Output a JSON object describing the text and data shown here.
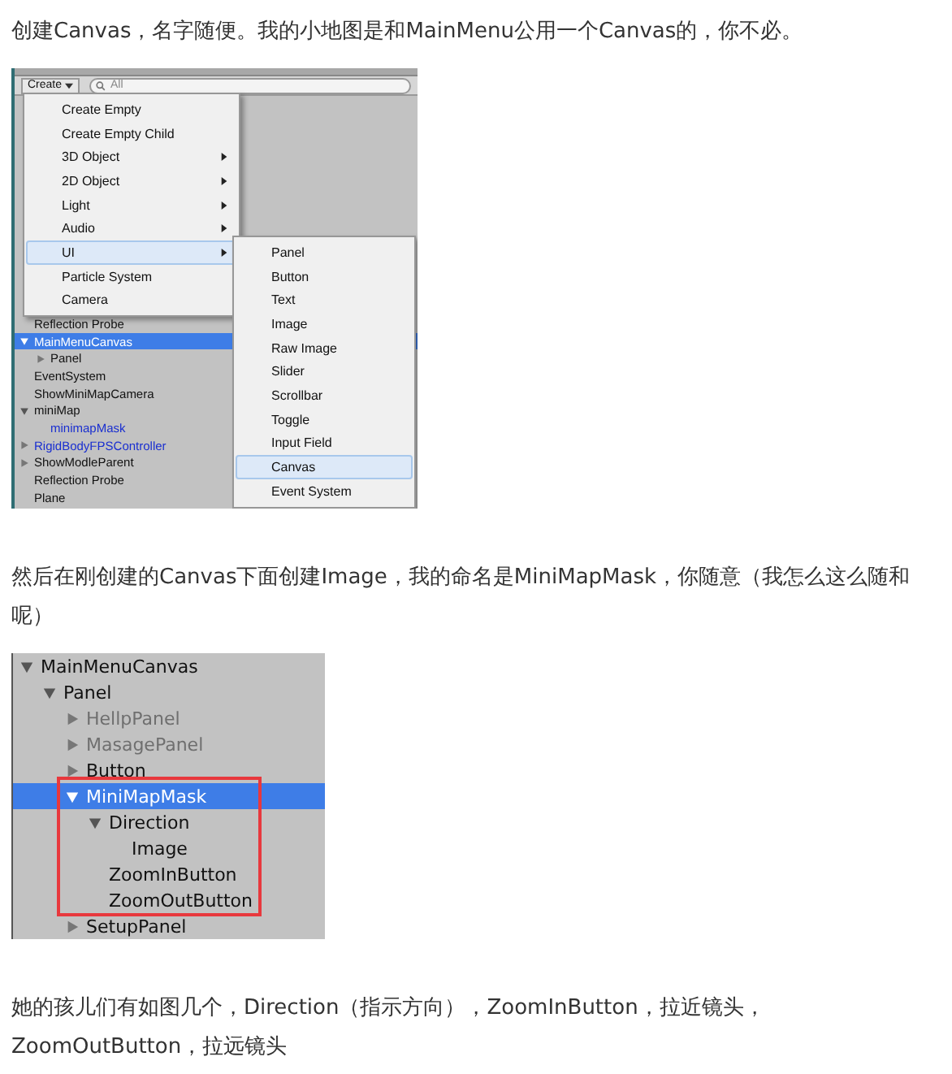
{
  "blocks": [
    {
      "kind": "text",
      "text": "创建Canvas，名字随便。我的小地图是和MainMenu公用一个Canvas的，你不必。"
    },
    {
      "kind": "menu_shot",
      "create_button": "Create",
      "search": {
        "placeholder": "All"
      },
      "menu": [
        {
          "label": "Create Empty",
          "submenu": false,
          "selected": false
        },
        {
          "label": "Create Empty Child",
          "submenu": false,
          "selected": false
        },
        {
          "label": "3D Object",
          "submenu": true,
          "selected": false
        },
        {
          "label": "2D Object",
          "submenu": true,
          "selected": false
        },
        {
          "label": "Light",
          "submenu": true,
          "selected": false
        },
        {
          "label": "Audio",
          "submenu": true,
          "selected": false
        },
        {
          "label": "UI",
          "submenu": true,
          "selected": true
        },
        {
          "label": "Particle System",
          "submenu": false,
          "selected": false
        },
        {
          "label": "Camera",
          "submenu": false,
          "selected": false
        }
      ],
      "submenu": [
        {
          "label": "Panel",
          "selected": false
        },
        {
          "label": "Button",
          "selected": false
        },
        {
          "label": "Text",
          "selected": false
        },
        {
          "label": "Image",
          "selected": false
        },
        {
          "label": "Raw Image",
          "selected": false
        },
        {
          "label": "Slider",
          "selected": false
        },
        {
          "label": "Scrollbar",
          "selected": false
        },
        {
          "label": "Toggle",
          "selected": false
        },
        {
          "label": "Input Field",
          "selected": false
        },
        {
          "label": "Canvas",
          "selected": true
        },
        {
          "label": "Event System",
          "selected": false
        }
      ],
      "tree": [
        {
          "label": "Reflection Probe",
          "kind": "object",
          "selected": false
        },
        {
          "label": "MainMenuCanvas",
          "expanded": true,
          "kind": "object",
          "selected": true,
          "children": [
            {
              "label": "Panel",
              "expanded": false,
              "kind": "object",
              "selected": false
            }
          ]
        },
        {
          "label": "EventSystem",
          "kind": "object",
          "selected": false
        },
        {
          "label": "ShowMiniMapCamera",
          "kind": "object",
          "selected": false
        },
        {
          "label": "miniMap",
          "expanded": true,
          "kind": "object",
          "selected": false,
          "children": [
            {
              "label": "minimapMask",
              "kind": "prefab",
              "selected": false
            }
          ]
        },
        {
          "label": "RigidBodyFPSController",
          "expanded": false,
          "kind": "prefab",
          "selected": false
        },
        {
          "label": "ShowModleParent",
          "expanded": false,
          "kind": "object",
          "selected": false
        },
        {
          "label": "Reflection Probe",
          "kind": "object",
          "selected": false
        },
        {
          "label": "Plane",
          "kind": "object",
          "selected": false
        }
      ]
    },
    {
      "kind": "text",
      "text": "然后在刚创建的Canvas下面创建Image，我的命名是MiniMapMask，你随意（我怎么这么随和呢）"
    },
    {
      "kind": "tree_shot",
      "tree": [
        {
          "label": "MainMenuCanvas",
          "expanded": true,
          "kind": "object",
          "selected": false,
          "children": [
            {
              "label": "Panel",
              "expanded": true,
              "kind": "object",
              "selected": false,
              "children": [
                {
                  "label": "HellpPanel",
                  "expanded": false,
                  "kind": "inactive",
                  "selected": false
                },
                {
                  "label": "MasagePanel",
                  "expanded": false,
                  "kind": "inactive",
                  "selected": false
                },
                {
                  "label": "Button",
                  "expanded": false,
                  "kind": "object",
                  "selected": false
                },
                {
                  "label": "MiniMapMask",
                  "expanded": true,
                  "kind": "object",
                  "selected": true,
                  "children": [
                    {
                      "label": "Direction",
                      "expanded": true,
                      "kind": "object",
                      "selected": false,
                      "children": [
                        {
                          "label": "Image",
                          "kind": "object",
                          "selected": false
                        }
                      ]
                    },
                    {
                      "label": "ZoomInButton",
                      "kind": "object",
                      "selected": false
                    },
                    {
                      "label": "ZoomOutButton",
                      "kind": "object",
                      "selected": false
                    }
                  ]
                },
                {
                  "label": "SetupPanel",
                  "expanded": false,
                  "kind": "object",
                  "selected": false
                }
              ]
            }
          ]
        }
      ]
    },
    {
      "kind": "text",
      "text": "她的孩儿们有如图几个，Direction（指示方向），ZoomInButton，拉近镜头，ZoomOutButton，拉远镜头"
    }
  ]
}
